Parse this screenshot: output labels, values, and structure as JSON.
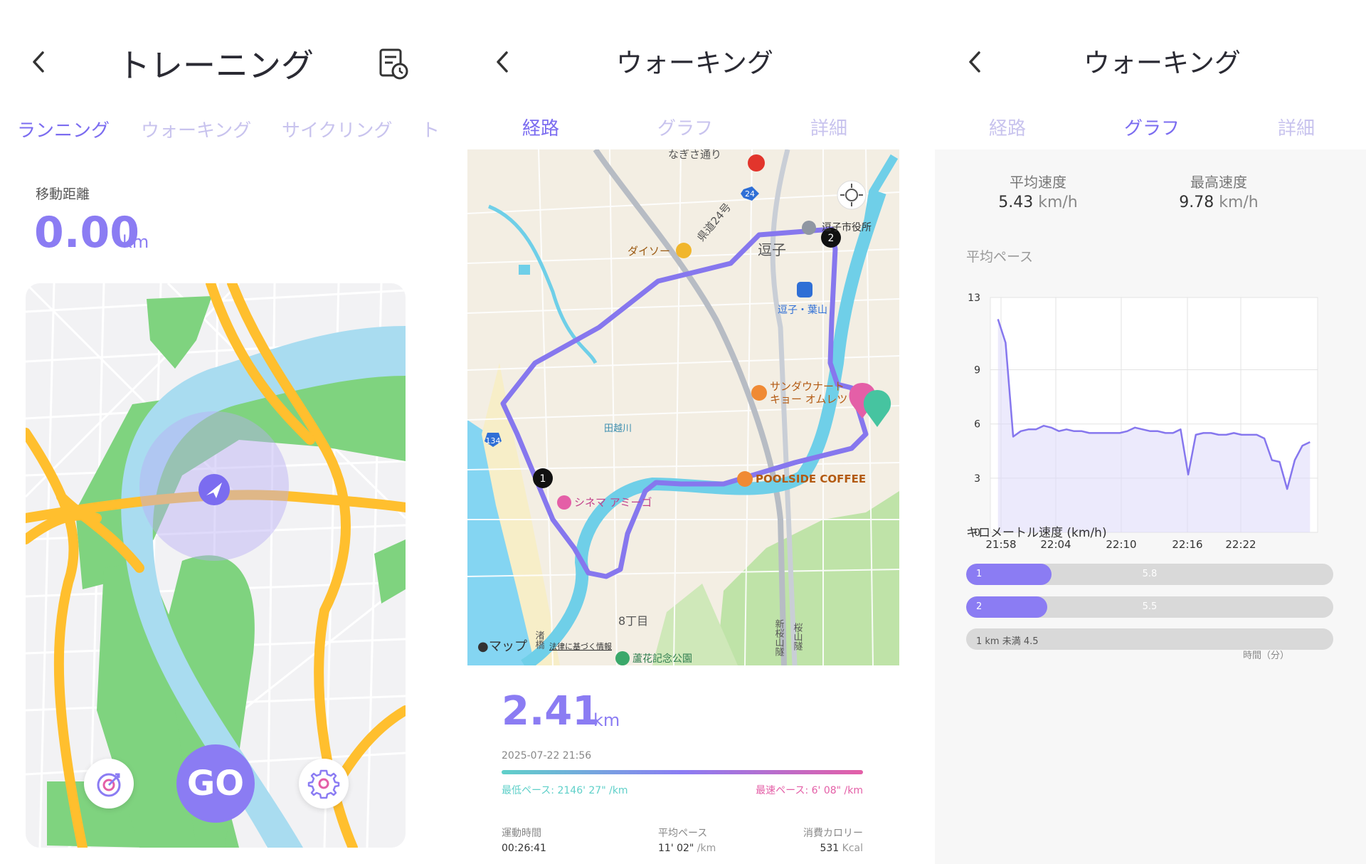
{
  "panel1": {
    "title": "トレーニング",
    "tabs": [
      "ランニング",
      "ウォーキング",
      "サイクリング",
      "ト"
    ],
    "distance_label": "移動距離",
    "distance_value": "0.00",
    "distance_unit": "km",
    "go_label": "GO",
    "icons": [
      "back-icon",
      "history-icon",
      "target-icon",
      "location-arrow-icon",
      "gear-icon"
    ]
  },
  "panel2": {
    "title": "ウォーキング",
    "tabs": [
      "経路",
      "グラフ",
      "詳細"
    ],
    "map": {
      "labels": {
        "street": "なぎさ通り",
        "route24": "24",
        "prefroad": "県道24号",
        "daiso": "ダイソー",
        "zushi": "逗子",
        "cityhall": "逗子市役所",
        "station": "逗子・葉山",
        "sunday1": "サンダウナート",
        "sunday2": "キョー オムレツ",
        "river": "田越川",
        "route134": "134",
        "cinema": "シネマ アミーゴ",
        "coffee": "POOLSIDE COFFEE",
        "district": "8丁目",
        "park": "蘆花記念公園",
        "tunnel1": "新桜山隧",
        "tunnel2": "桜山隧",
        "nagisa": "渚橋",
        "apple_maps": "マップ",
        "legal": "法律に基づく情報",
        "marker1": "1",
        "marker2": "2"
      }
    },
    "distance_value": "2.41",
    "distance_unit": "km",
    "datetime": "2025-07-22 21:56",
    "slowest_pace": "最低ペース: 2146' 27\" /km",
    "fastest_pace": "最速ペース: 6' 08\" /km",
    "stats": [
      {
        "label": "運動時間",
        "value": "00:26:41",
        "unit": ""
      },
      {
        "label": "平均ペース",
        "value": "11' 02\"",
        "unit": "/km"
      },
      {
        "label": "消費カロリー",
        "value": "531",
        "unit": "Kcal"
      }
    ]
  },
  "panel3": {
    "title": "ウォーキング",
    "tabs": [
      "経路",
      "グラフ",
      "詳細"
    ],
    "avg_speed_label": "平均速度",
    "avg_speed_value": "5.43",
    "avg_speed_unit": "km/h",
    "max_speed_label": "最高速度",
    "max_speed_value": "9.78",
    "max_speed_unit": "km/h",
    "pace_section_label": "平均ペース",
    "km_speed_label": "キロメートル速度 (km/h)",
    "km_bars": [
      {
        "label": "1",
        "value": 5.8,
        "text": "5.8"
      },
      {
        "label": "2",
        "value": 5.5,
        "text": "5.5"
      },
      {
        "label": "1 km 未満 4.5",
        "value": 4.5,
        "text": ""
      }
    ]
  },
  "chart_data": {
    "type": "area",
    "title": "平均ペース",
    "xlabel": "時間（分）",
    "ylabel": "",
    "x_ticks": [
      "21:58",
      "22:04",
      "22:10",
      "22:16",
      "22:22"
    ],
    "y_ticks": [
      0,
      3,
      6,
      9,
      13
    ],
    "ylim": [
      0,
      13
    ],
    "xlim": [
      21.95,
      22.38
    ],
    "grid": true,
    "series": [
      {
        "x": [
          21.96,
          21.97,
          21.98,
          21.99,
          22.0,
          22.01,
          22.02,
          22.03,
          22.04,
          22.05,
          22.06,
          22.07,
          22.08,
          22.09,
          22.1,
          22.11,
          22.12,
          22.13,
          22.14,
          22.15,
          22.16,
          22.17,
          22.18,
          22.19,
          22.2,
          22.21,
          22.22,
          22.23,
          22.24,
          22.25,
          22.26,
          22.27,
          22.28,
          22.29,
          22.3,
          22.31,
          22.32,
          22.33,
          22.34,
          22.35,
          22.36,
          22.37
        ],
        "y": [
          11.8,
          10.5,
          5.3,
          5.6,
          5.7,
          5.7,
          5.9,
          5.8,
          5.6,
          5.7,
          5.6,
          5.6,
          5.5,
          5.5,
          5.5,
          5.5,
          5.5,
          5.6,
          5.8,
          5.7,
          5.6,
          5.6,
          5.5,
          5.5,
          5.7,
          3.2,
          5.4,
          5.5,
          5.5,
          5.4,
          5.4,
          5.5,
          5.4,
          5.4,
          5.4,
          5.2,
          4.0,
          3.9,
          2.4,
          4.0,
          4.8,
          5.0
        ]
      }
    ]
  }
}
